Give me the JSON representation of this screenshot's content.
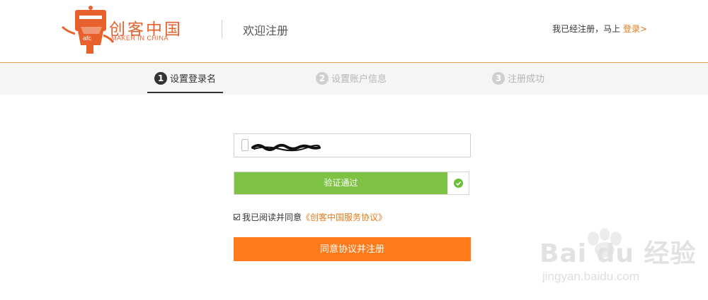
{
  "header": {
    "logo_cn": "创客中国",
    "logo_en": "MAKER IN CHINA",
    "title": "欢迎注册",
    "already_registered": "我已经注册，马上",
    "login_label": "登录>"
  },
  "steps": [
    {
      "num": "1",
      "label": "设置登录名",
      "active": true
    },
    {
      "num": "2",
      "label": "设置账户信息",
      "active": false
    },
    {
      "num": "3",
      "label": "注册成功",
      "active": false
    }
  ],
  "form": {
    "phone_value": "",
    "verify_label": "验证通过",
    "agree_prefix": "我已阅读并同意",
    "agree_link": "《创客中国服务协议》",
    "agree_checked": true,
    "submit_label": "同意协议并注册"
  },
  "watermark": {
    "brand_text": "Bai du 经验",
    "url": "jingyan.baidu.com"
  },
  "colors": {
    "brand": "#e8612c",
    "link": "#e07c1b",
    "success": "#7dc242",
    "button": "#ff7a1b"
  }
}
